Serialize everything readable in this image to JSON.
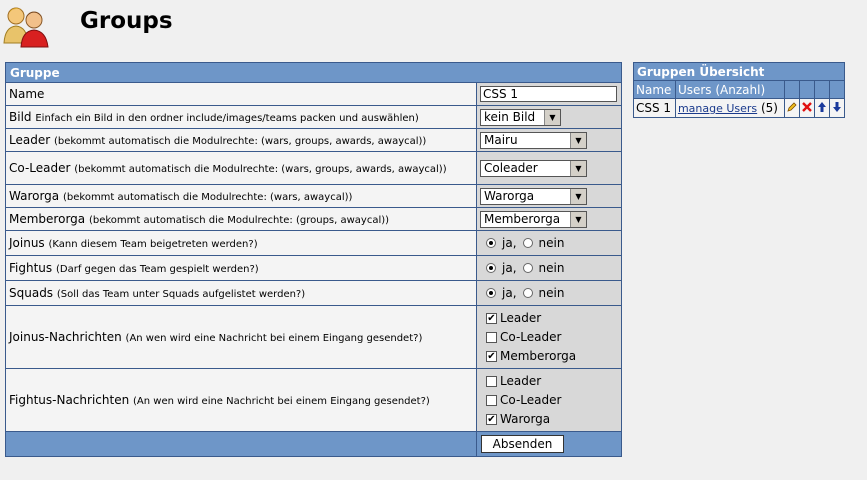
{
  "page": {
    "title": "Groups"
  },
  "form": {
    "section_title": "Gruppe",
    "name": {
      "label": "Name",
      "value": "CSS 1"
    },
    "bild": {
      "label": "Bild",
      "hint": "Einfach ein Bild in den ordner include/images/teams packen und auswählen)",
      "selected": "kein Bild"
    },
    "leader": {
      "label": "Leader",
      "hint": "(bekommt automatisch die Modulrechte: (wars, groups, awards, awaycal))",
      "selected": "Mairu"
    },
    "coleader": {
      "label": "Co-Leader",
      "hint": "(bekommt automatisch die Modulrechte: (wars, groups, awards, awaycal))",
      "selected": "Coleader"
    },
    "warorga": {
      "label": "Warorga",
      "hint": "(bekommt automatisch die Modulrechte: (wars, awaycal))",
      "selected": "Warorga"
    },
    "memberorga": {
      "label": "Memberorga",
      "hint": "(bekommt automatisch die Modulrechte: (groups, awaycal))",
      "selected": "Memberorga"
    },
    "joinus": {
      "label": "Joinus",
      "hint": "(Kann diesem Team beigetreten werden?)",
      "yes": "ja,",
      "no": "nein",
      "value": "ja"
    },
    "fightus": {
      "label": "Fightus",
      "hint": "(Darf gegen das Team gespielt werden?)",
      "yes": "ja,",
      "no": "nein",
      "value": "ja"
    },
    "squads": {
      "label": "Squads",
      "hint": "(Soll das Team unter Squads aufgelistet werden?)",
      "yes": "ja,",
      "no": "nein",
      "value": "ja"
    },
    "joinus_msgs": {
      "label": "Joinus-Nachrichten",
      "hint": "(An wen wird eine Nachricht bei einem Eingang gesendet?)",
      "options": [
        {
          "label": "Leader",
          "checked": true
        },
        {
          "label": "Co-Leader",
          "checked": false
        },
        {
          "label": "Memberorga",
          "checked": true
        }
      ]
    },
    "fightus_msgs": {
      "label": "Fightus-Nachrichten",
      "hint": "(An wen wird eine Nachricht bei einem Eingang gesendet?)",
      "options": [
        {
          "label": "Leader",
          "checked": false
        },
        {
          "label": "Co-Leader",
          "checked": false
        },
        {
          "label": "Warorga",
          "checked": true
        }
      ]
    },
    "submit_label": "Absenden"
  },
  "overview": {
    "title": "Gruppen Übersicht",
    "col_name": "Name",
    "col_users": "Users (Anzahl)",
    "rows": [
      {
        "name": "CSS 1",
        "link": "manage Users",
        "count": "(5)"
      }
    ]
  },
  "colors": {
    "header_blue": "#6e96c8",
    "border": "#3a5a8c",
    "value_bg": "#d8d8d8"
  }
}
